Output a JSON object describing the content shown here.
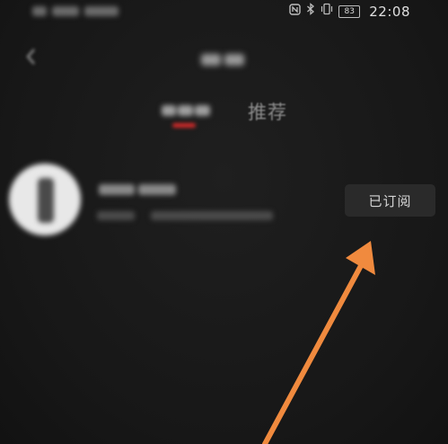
{
  "status_bar": {
    "time": "22:08",
    "battery_level": "83",
    "icons": [
      "nfc-icon",
      "bluetooth-icon",
      "vibrate-icon",
      "battery-icon"
    ]
  },
  "header": {
    "back_icon": "chevron-left-icon"
  },
  "tabs": [
    {
      "label": "推荐",
      "selected": false
    }
  ],
  "subscription_list": [
    {
      "subscribe_button_label": "已订阅"
    }
  ],
  "colors": {
    "background": "#181818",
    "tab_indicator": "#d62a2a",
    "button_background": "#2a2a2a",
    "annotation_arrow": "#f08a3e"
  }
}
